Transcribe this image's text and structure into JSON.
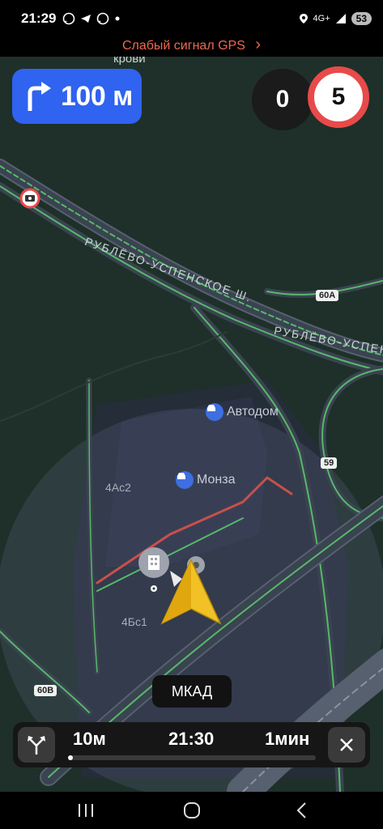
{
  "status_bar": {
    "time": "21:29",
    "app_icons": [
      "whatsapp-icon",
      "telegram-icon",
      "whatsapp-icon",
      "dot-icon"
    ],
    "network": "4G+",
    "battery": "53"
  },
  "gps_banner": {
    "text": "Слабый сигнал GPS",
    "chevron": "›",
    "color": "#f0674f"
  },
  "maneuver": {
    "direction": "turn-right",
    "distance": "100 м",
    "color": "#2f63f0"
  },
  "speed": {
    "current": "0",
    "limit": "5",
    "limit_ring_color": "#e84a4a"
  },
  "map": {
    "top_fragment": "крови",
    "road_labels": [
      "РУБЛЁВО-УСПЕНСКОЕ Ш.",
      "РУБЛЁВО-УСПЕН"
    ],
    "road_tags": [
      "60А",
      "59",
      "60В"
    ],
    "pois": [
      {
        "name": "Автодом",
        "icon": "car-icon"
      },
      {
        "name": "Монза",
        "icon": "car-icon"
      }
    ],
    "buildings": [
      "4Ас2",
      "4Бс1"
    ],
    "street_chip": "МКАД"
  },
  "route_bar": {
    "distance": "10м",
    "arrival_time": "21:30",
    "duration": "1мин",
    "progress": 0.02
  },
  "nav_bar": {
    "buttons": [
      "recent-apps-icon",
      "home-icon",
      "back-icon"
    ]
  }
}
